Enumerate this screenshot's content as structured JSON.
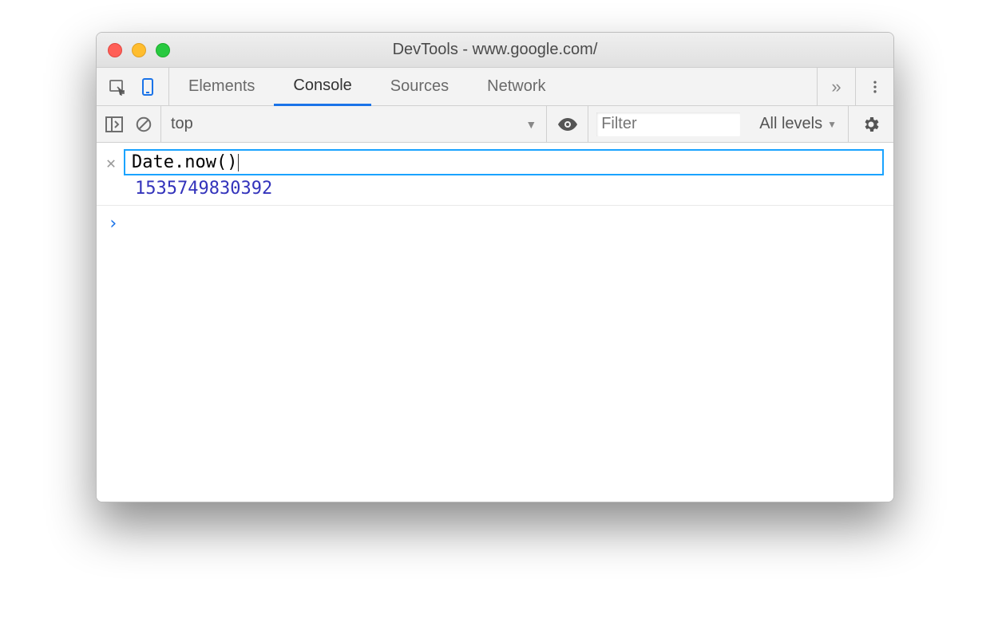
{
  "window": {
    "title": "DevTools - www.google.com/"
  },
  "tabs": {
    "items": [
      "Elements",
      "Console",
      "Sources",
      "Network"
    ],
    "active_index": 1
  },
  "toolbar": {
    "context": "top",
    "filter_placeholder": "Filter",
    "levels_label": "All levels"
  },
  "console": {
    "live_expression": "Date.now()",
    "live_result": "1535749830392"
  }
}
